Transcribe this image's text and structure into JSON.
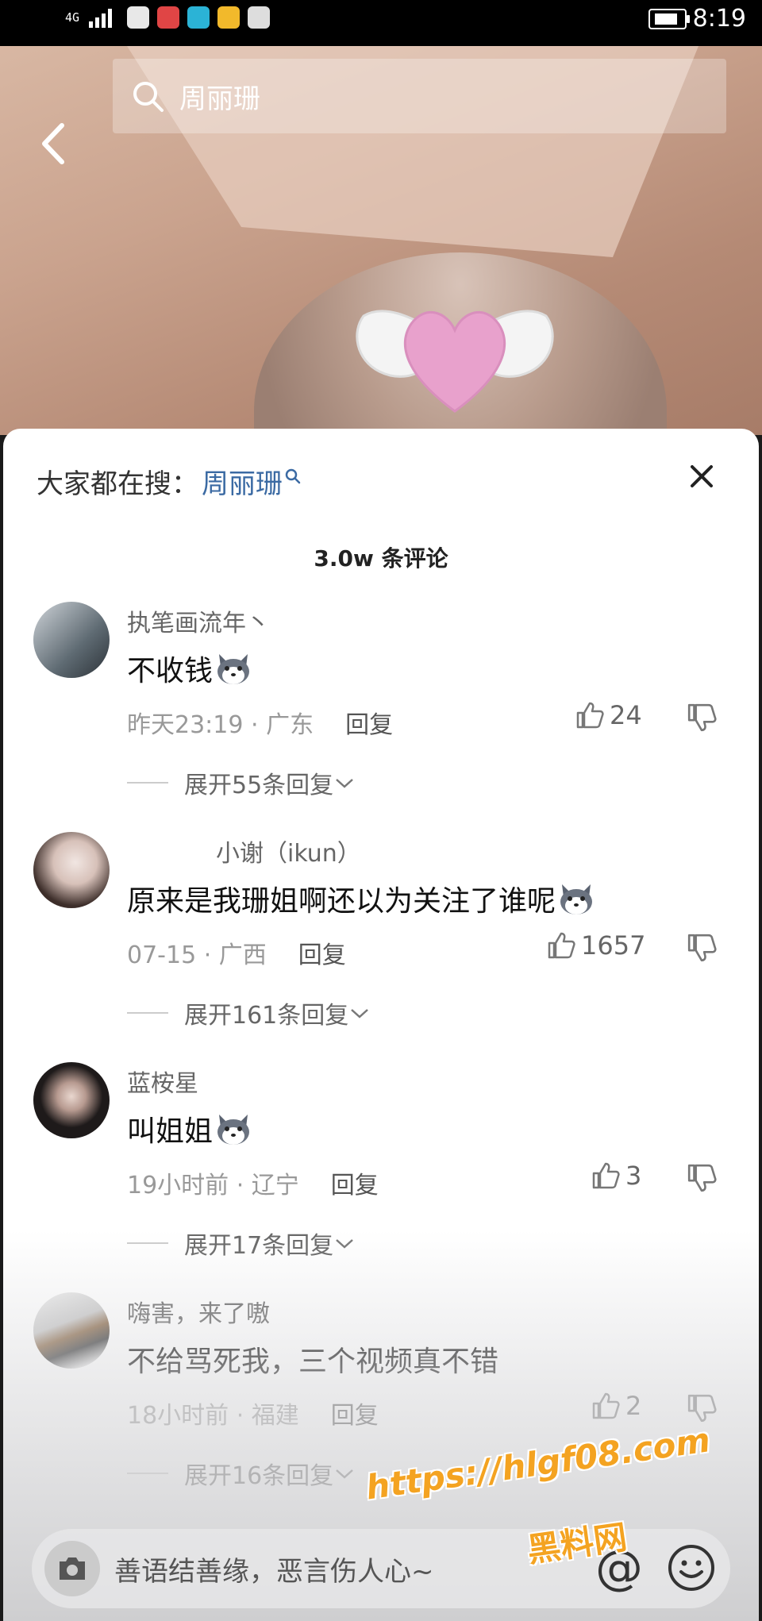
{
  "statusbar": {
    "network": "4G",
    "time": "8:19"
  },
  "search": {
    "query": "周丽珊"
  },
  "sheet": {
    "hot_prefix": "大家都在搜：",
    "hot_keyword": "周丽珊",
    "comment_count": "3.0w 条评论"
  },
  "comments": [
    {
      "name": "执笔画流年丶",
      "text": "不收钱",
      "time_loc": "昨天23:19 · 广东",
      "reply": "回复",
      "likes": "24",
      "expand": "展开55条回复"
    },
    {
      "name": "小谢（ikun）",
      "text": "原来是我珊姐啊还以为关注了谁呢",
      "time_loc": "07-15 · 广西",
      "reply": "回复",
      "likes": "1657",
      "expand": "展开161条回复"
    },
    {
      "name": "蓝桉星",
      "text": "叫姐姐",
      "time_loc": "19小时前 · 辽宁",
      "reply": "回复",
      "likes": "3",
      "expand": "展开17条回复"
    },
    {
      "name": "嗨害，来了嗷",
      "text": "不给骂死我，三个视频真不错",
      "time_loc": "18小时前 · 福建",
      "reply": "回复",
      "likes": "2",
      "expand": "展开16条回复"
    }
  ],
  "input": {
    "placeholder": "善语结善缘，恶言伤人心~",
    "at": "@"
  },
  "watermark": {
    "url": "https://hlgf08.com",
    "name": "黑料网"
  },
  "colors": {
    "keyword": "#3b6aa3",
    "watermark": "#f4a321"
  }
}
